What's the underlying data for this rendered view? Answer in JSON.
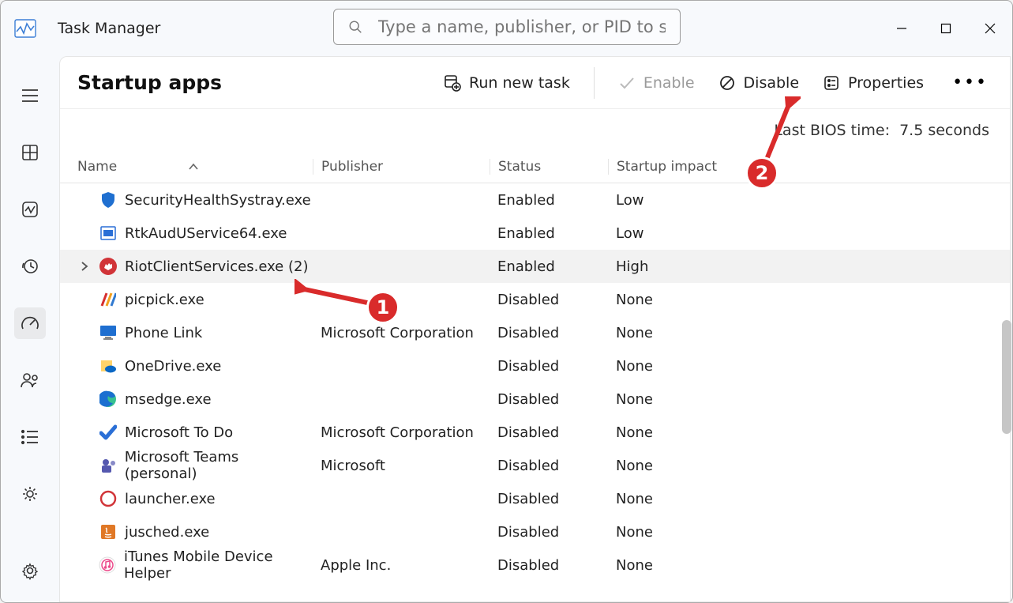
{
  "app": {
    "title": "Task Manager"
  },
  "search": {
    "placeholder": "Type a name, publisher, or PID to se..."
  },
  "page_title": "Startup apps",
  "toolbar": {
    "run_new_task": "Run new task",
    "enable": "Enable",
    "disable": "Disable",
    "properties": "Properties"
  },
  "bios": {
    "label": "Last BIOS time:",
    "value": "7.5 seconds"
  },
  "columns": {
    "name": "Name",
    "publisher": "Publisher",
    "status": "Status",
    "impact": "Startup impact"
  },
  "rows": [
    {
      "icon": "shield",
      "icon_color": "#1f6fd0",
      "name": "SecurityHealthSystray.exe",
      "publisher": "",
      "status": "Enabled",
      "impact": "Low",
      "expandable": false,
      "selected": false
    },
    {
      "icon": "app",
      "icon_color": "#2a6fd6",
      "name": "RtkAudUService64.exe",
      "publisher": "",
      "status": "Enabled",
      "impact": "Low",
      "expandable": false,
      "selected": false
    },
    {
      "icon": "fist",
      "icon_color": "#d13438",
      "name": "RiotClientServices.exe (2)",
      "publisher": "",
      "status": "Enabled",
      "impact": "High",
      "expandable": true,
      "selected": true
    },
    {
      "icon": "stripes",
      "icon_color": "#e06a2b",
      "name": "picpick.exe",
      "publisher": "",
      "status": "Disabled",
      "impact": "None",
      "expandable": false,
      "selected": false
    },
    {
      "icon": "monitor",
      "icon_color": "#1f6fd0",
      "name": "Phone Link",
      "publisher": "Microsoft Corporation",
      "status": "Disabled",
      "impact": "None",
      "expandable": false,
      "selected": false
    },
    {
      "icon": "cloud",
      "icon_color": "#0a67c4",
      "name": "OneDrive.exe",
      "publisher": "",
      "status": "Disabled",
      "impact": "None",
      "expandable": false,
      "selected": false
    },
    {
      "icon": "edge",
      "icon_color": "#1a9e6f",
      "name": "msedge.exe",
      "publisher": "",
      "status": "Disabled",
      "impact": "None",
      "expandable": false,
      "selected": false
    },
    {
      "icon": "check",
      "icon_color": "#2a6fd6",
      "name": "Microsoft To Do",
      "publisher": "Microsoft Corporation",
      "status": "Disabled",
      "impact": "None",
      "expandable": false,
      "selected": false
    },
    {
      "icon": "teams",
      "icon_color": "#5558af",
      "name": "Microsoft Teams (personal)",
      "publisher": "Microsoft",
      "status": "Disabled",
      "impact": "None",
      "expandable": false,
      "selected": false
    },
    {
      "icon": "circle-o",
      "icon_color": "#d13438",
      "name": "launcher.exe",
      "publisher": "",
      "status": "Disabled",
      "impact": "None",
      "expandable": false,
      "selected": false
    },
    {
      "icon": "java",
      "icon_color": "#e07826",
      "name": "jusched.exe",
      "publisher": "",
      "status": "Disabled",
      "impact": "None",
      "expandable": false,
      "selected": false
    },
    {
      "icon": "music",
      "icon_color": "#ec4a8a",
      "name": "iTunes Mobile Device Helper",
      "publisher": "Apple Inc.",
      "status": "Disabled",
      "impact": "None",
      "expandable": false,
      "selected": false
    }
  ],
  "annotations": {
    "badge1": "1",
    "badge2": "2"
  }
}
